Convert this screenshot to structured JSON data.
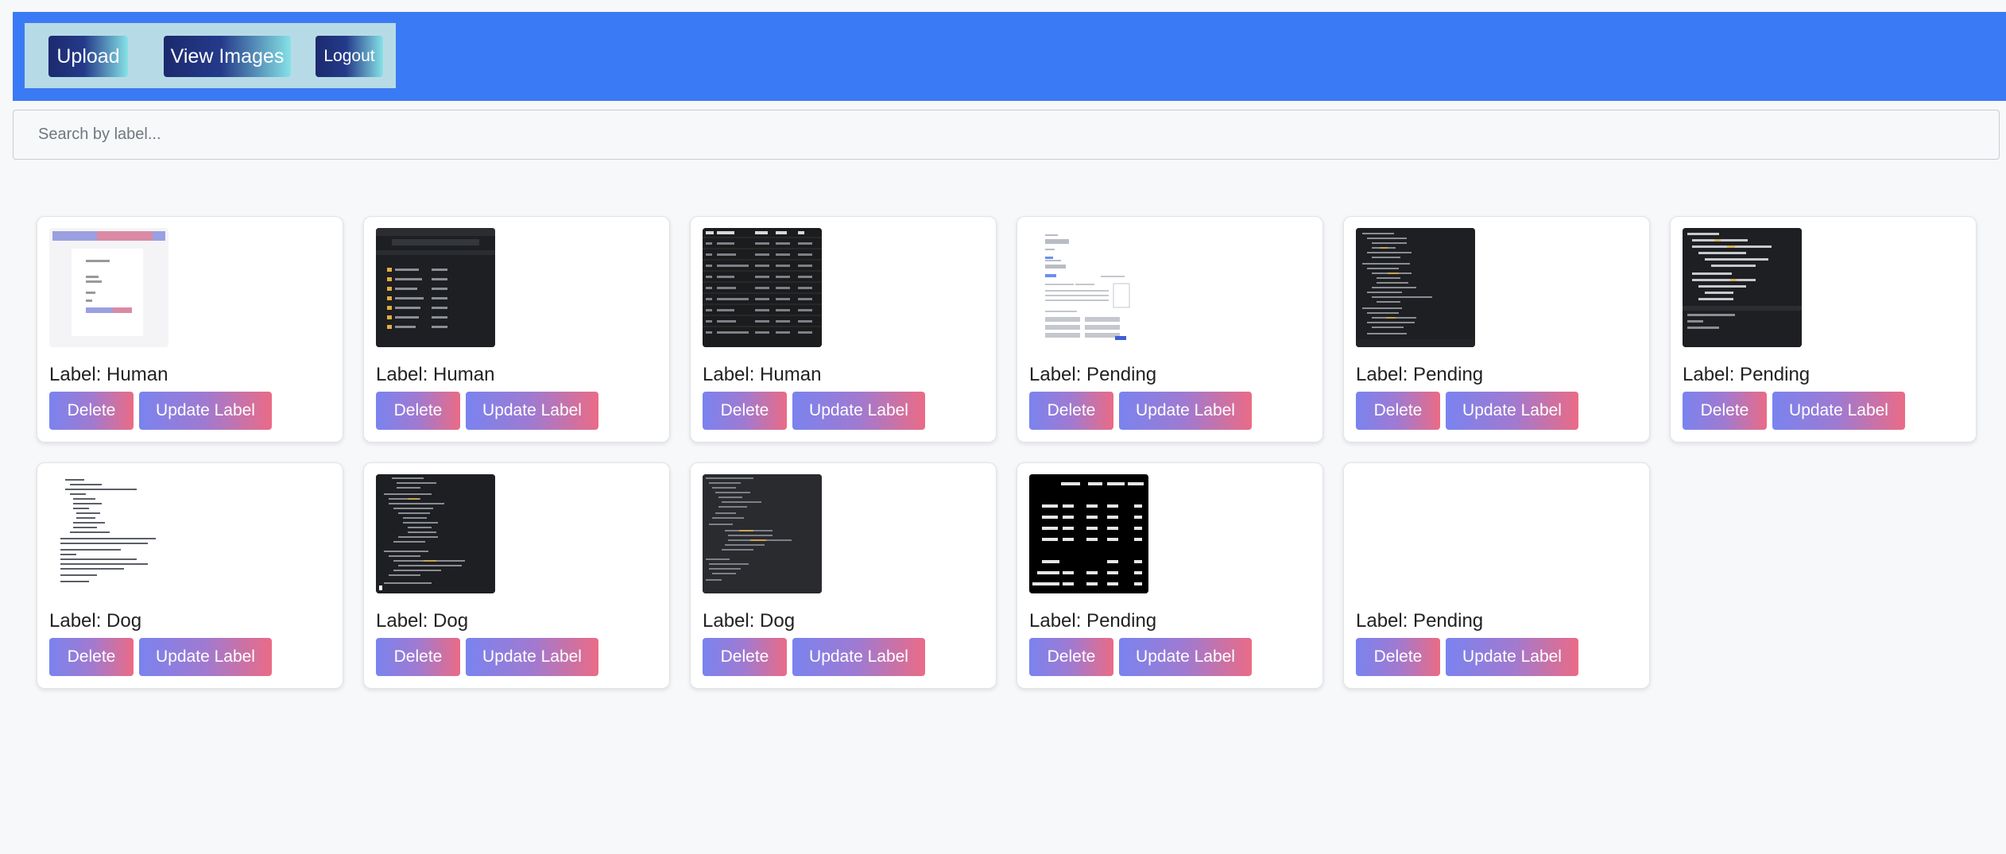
{
  "nav": {
    "upload": "Upload",
    "view_images": "View Images",
    "logout": "Logout"
  },
  "search": {
    "placeholder": "Search by label..."
  },
  "buttons": {
    "delete": "Delete",
    "update": "Update Label"
  },
  "cards": [
    {
      "label": "Label: Human",
      "thumbnail": "form-screenshot"
    },
    {
      "label": "Label: Human",
      "thumbnail": "file-explorer-screenshot"
    },
    {
      "label": "Label: Human",
      "thumbnail": "results-table-screenshot"
    },
    {
      "label": "Label: Pending",
      "thumbnail": "web-form-screenshot"
    },
    {
      "label": "Label: Pending",
      "thumbnail": "code-editor-screenshot"
    },
    {
      "label": "Label: Pending",
      "thumbnail": "code-editor-screenshot"
    },
    {
      "label": "Label: Dog",
      "thumbnail": "code-text-screenshot"
    },
    {
      "label": "Label: Dog",
      "thumbnail": "code-editor-screenshot"
    },
    {
      "label": "Label: Dog",
      "thumbnail": "code-editor-screenshot"
    },
    {
      "label": "Label: Pending",
      "thumbnail": "classification-report-screenshot"
    },
    {
      "label": "Label: Pending",
      "thumbnail": "blank-image"
    }
  ],
  "colors": {
    "topbar": "#3b7af5",
    "navbox": "#b7dbe6",
    "button_gradient_start": "#7a83ef",
    "button_gradient_end": "#ea6b86"
  }
}
